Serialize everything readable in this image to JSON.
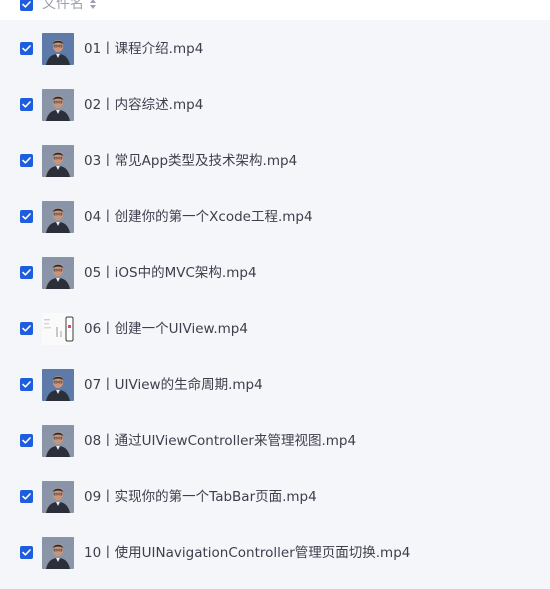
{
  "header": {
    "column_label": "文件名",
    "checkbox_checked": true
  },
  "colors": {
    "accent": "#1d5de0",
    "list_background": "#f5f6fa",
    "text": "#3c3f4c",
    "header_text": "#9ba0ad"
  },
  "files": [
    {
      "name": "01丨课程介绍.mp4",
      "checked": true,
      "thumb": "person-blue"
    },
    {
      "name": "02丨内容综述.mp4",
      "checked": true,
      "thumb": "person-grey"
    },
    {
      "name": "03丨常见App类型及技术架构.mp4",
      "checked": true,
      "thumb": "person-grey"
    },
    {
      "name": "04丨创建你的第一个Xcode工程.mp4",
      "checked": true,
      "thumb": "person-grey"
    },
    {
      "name": "05丨iOS中的MVC架构.mp4",
      "checked": true,
      "thumb": "person-grey"
    },
    {
      "name": "06丨创建一个UIView.mp4",
      "checked": true,
      "thumb": "screen-demo"
    },
    {
      "name": "07丨UIView的生命周期.mp4",
      "checked": true,
      "thumb": "person-blue"
    },
    {
      "name": "08丨通过UIViewController来管理视图.mp4",
      "checked": true,
      "thumb": "person-grey"
    },
    {
      "name": "09丨实现你的第一个TabBar页面.mp4",
      "checked": true,
      "thumb": "person-grey"
    },
    {
      "name": "10丨使用UINavigationController管理页面切换.mp4",
      "checked": true,
      "thumb": "person-grey"
    }
  ]
}
